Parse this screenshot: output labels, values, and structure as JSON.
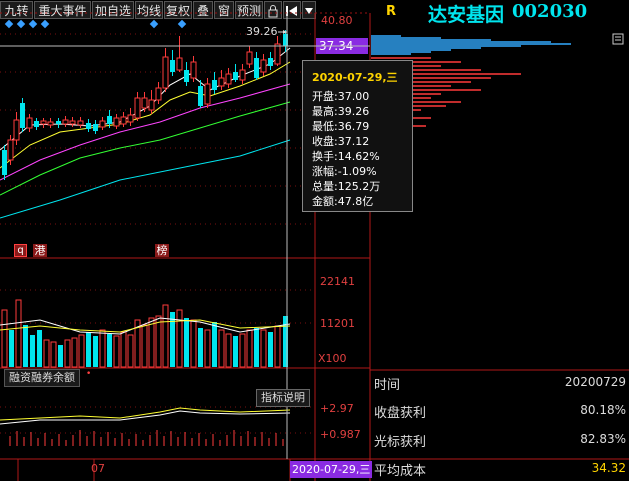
{
  "toolbar": {
    "buttons": [
      "九转",
      "重大事件",
      "加自选",
      "均线",
      "复权",
      "叠",
      "窗",
      "预测"
    ]
  },
  "header": {
    "r_label": "R",
    "stock_name": "达安基因",
    "stock_code": "002030",
    "price_top": "40.80",
    "price_current": "37.34"
  },
  "chart": {
    "peak_label": "39.26"
  },
  "markers": {
    "q": "q",
    "gang": "港",
    "bang": "榜"
  },
  "volume": {
    "ticks": [
      "22141",
      "11201"
    ],
    "unit": "X100"
  },
  "margin": {
    "title": "融资融券余额",
    "explain_button": "指标说明",
    "ticks": [
      "+2.97",
      "+0.987"
    ]
  },
  "xaxis": {
    "month_label": "07",
    "cursor_date": "2020-07-29,三"
  },
  "tooltip": {
    "date": "2020-07-29,三",
    "rows": [
      {
        "k": "开盘:",
        "v": "37.00"
      },
      {
        "k": "最高:",
        "v": "39.26"
      },
      {
        "k": "最低:",
        "v": "36.79"
      },
      {
        "k": "收盘:",
        "v": "37.12"
      },
      {
        "k": "换手:",
        "v": "14.62%"
      },
      {
        "k": "涨幅:",
        "v": "-1.09%"
      },
      {
        "k": "总量:",
        "v": "125.2万"
      },
      {
        "k": "金额:",
        "v": "47.8亿"
      }
    ]
  },
  "info": {
    "rows": [
      {
        "k": "时间",
        "v": "20200729"
      },
      {
        "k": "收盘获利",
        "v": "80.18%"
      },
      {
        "k": "光标获利",
        "v": "82.83%"
      },
      {
        "k": "平均成本",
        "v": "34.32"
      }
    ]
  },
  "colors": {
    "up": "#ff3b3b",
    "down": "#00e5ee",
    "ma5": "#ffffff",
    "ma10": "#ffff33",
    "ma20": "#ff44ff",
    "ma30": "#33ff33",
    "ma60": "#00e5ee"
  }
}
